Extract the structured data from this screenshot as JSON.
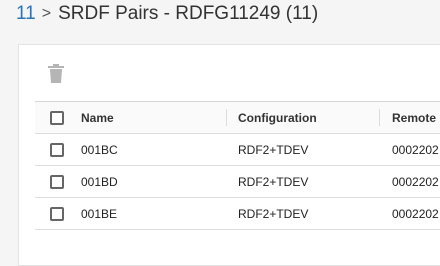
{
  "breadcrumb": {
    "parent": "11",
    "separator": ">",
    "title": "SRDF Pairs - RDFG11249 (11)"
  },
  "toolbar": {
    "delete_icon": "trash-icon"
  },
  "table": {
    "columns": [
      "Name",
      "Configuration",
      "Remote"
    ],
    "rows": [
      {
        "name": "001BC",
        "configuration": "RDF2+TDEV",
        "remote": "0002202"
      },
      {
        "name": "001BD",
        "configuration": "RDF2+TDEV",
        "remote": "0002202"
      },
      {
        "name": "001BE",
        "configuration": "RDF2+TDEV",
        "remote": "0002202"
      }
    ]
  },
  "colors": {
    "link": "#2a74b8",
    "icon_disabled": "#b5b5b5"
  }
}
